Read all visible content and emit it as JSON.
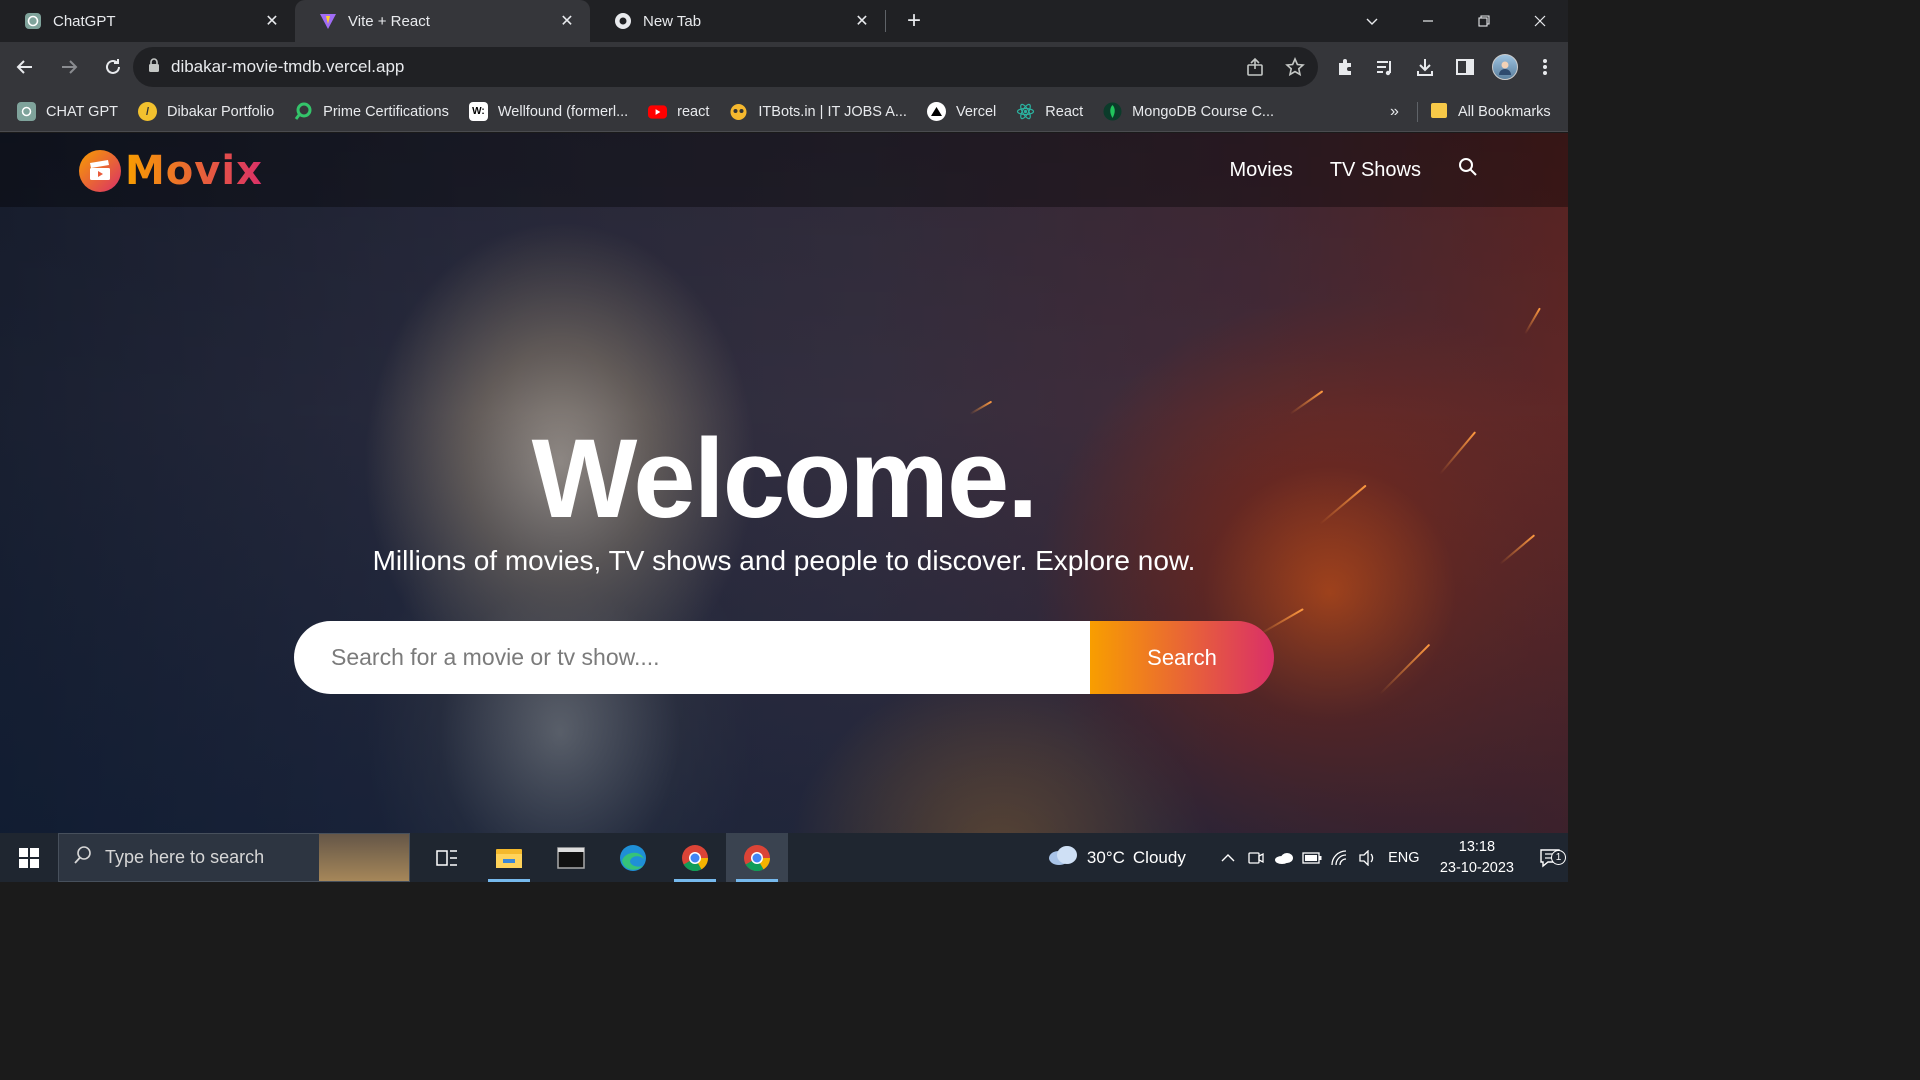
{
  "browser": {
    "tabs": [
      {
        "title": "ChatGPT",
        "icon": "chatgpt-icon",
        "active": false
      },
      {
        "title": "Vite + React",
        "icon": "vite-icon",
        "active": true
      },
      {
        "title": "New Tab",
        "icon": "chrome-icon",
        "active": false
      }
    ],
    "url": "dibakar-movie-tmdb.vercel.app",
    "bookmarks": [
      {
        "label": "CHAT GPT",
        "icon": "chatgpt-icon"
      },
      {
        "label": "Dibakar Portfolio",
        "icon": "portfolio-icon"
      },
      {
        "label": "Prime Certifications",
        "icon": "prime-icon"
      },
      {
        "label": "Wellfound (formerl...",
        "icon": "wellfound-icon"
      },
      {
        "label": "react",
        "icon": "youtube-icon"
      },
      {
        "label": "ITBots.in | IT JOBS A...",
        "icon": "itbots-icon"
      },
      {
        "label": "Vercel",
        "icon": "vercel-icon"
      },
      {
        "label": "React",
        "icon": "react-icon"
      },
      {
        "label": "MongoDB Course C...",
        "icon": "mongodb-icon"
      }
    ],
    "more_bookmarks": "»",
    "all_bookmarks": "All Bookmarks"
  },
  "site": {
    "logo_text": "Movix",
    "nav": {
      "movies": "Movies",
      "tv_shows": "TV Shows"
    },
    "hero": {
      "title": "Welcome.",
      "subtitle": "Millions of movies, TV shows and people to discover. Explore now.",
      "search_placeholder": "Search for a movie or tv show....",
      "search_button": "Search"
    },
    "colors": {
      "gradient_start": "#f89e00",
      "gradient_end": "#da2f68"
    }
  },
  "taskbar": {
    "search_placeholder": "Type here to search",
    "weather": {
      "temp": "30°C",
      "condition": "Cloudy"
    },
    "language": "ENG",
    "time": "13:18",
    "date": "23-10-2023",
    "notification_count": "1"
  }
}
